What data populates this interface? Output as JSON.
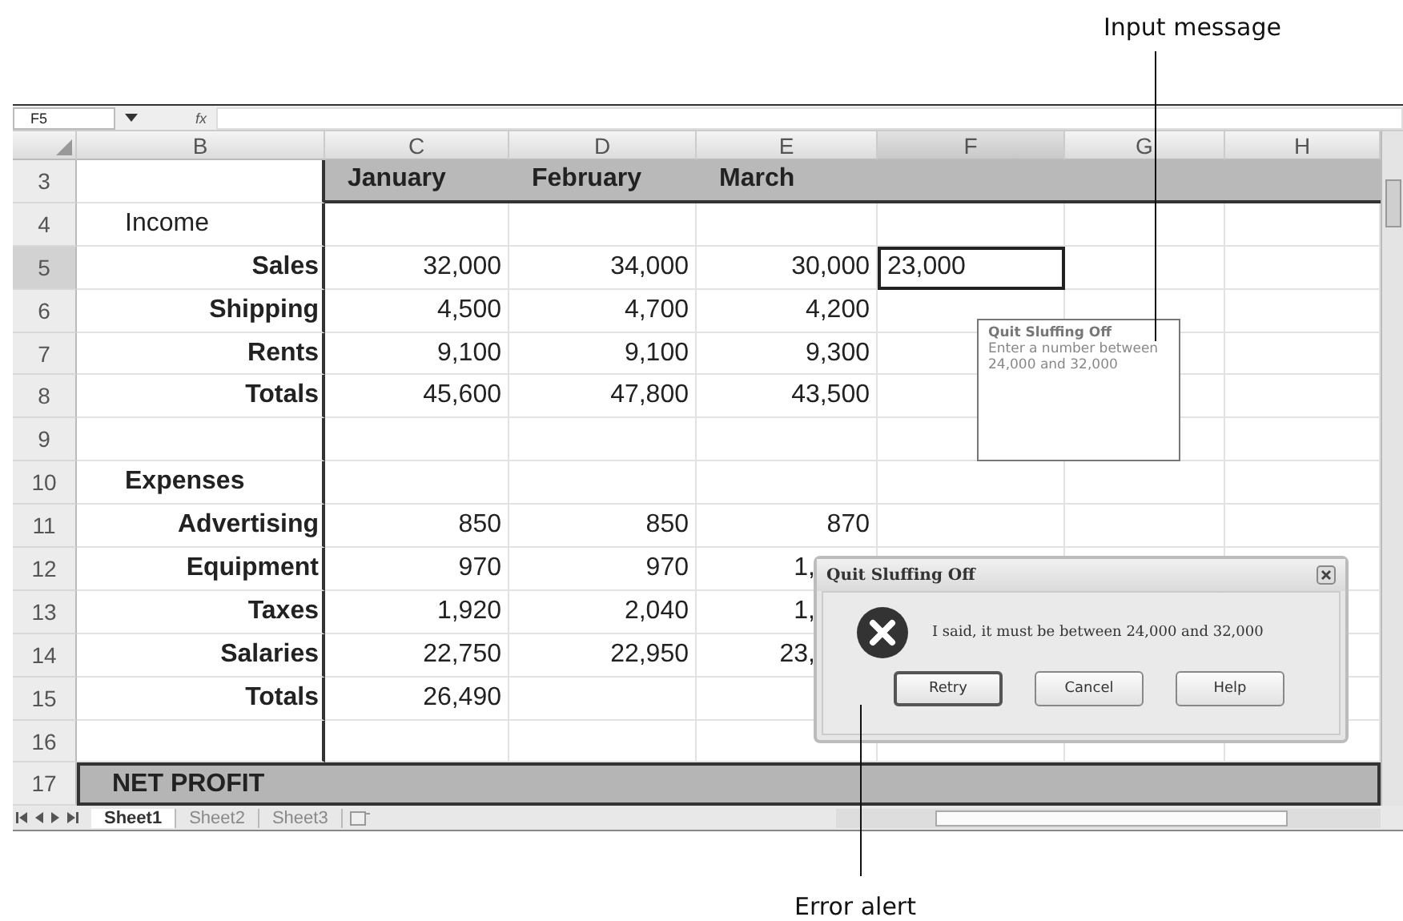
{
  "callouts": [
    {
      "kind": "top",
      "text": "Input message"
    },
    {
      "kind": "bottom",
      "text": "Error alert"
    }
  ],
  "formula_bar": {
    "name_box": "F5",
    "function_label": "fx"
  },
  "columns": [
    {
      "letter": "B",
      "selected": false
    },
    {
      "letter": "C",
      "selected": false
    },
    {
      "letter": "D",
      "selected": false
    },
    {
      "letter": "E",
      "selected": false
    },
    {
      "letter": "F",
      "selected": true
    },
    {
      "letter": "G",
      "selected": false
    },
    {
      "letter": "H",
      "selected": false
    }
  ],
  "rows": [
    {
      "number": "3",
      "kind": "header",
      "selected": false,
      "cells": [
        {
          "text": "January",
          "selected": false
        },
        {
          "text": "February",
          "selected": false
        },
        {
          "text": "March",
          "selected": false
        },
        null,
        null,
        null
      ]
    },
    {
      "number": "4",
      "kind": "group",
      "selected": false,
      "label": "Income",
      "bold": false,
      "cells": [
        null,
        null,
        null,
        null,
        null,
        null
      ]
    },
    {
      "number": "5",
      "kind": "item",
      "selected": true,
      "label": "Sales",
      "cells": [
        {
          "text": "32,000",
          "selected": false
        },
        {
          "text": "34,000",
          "selected": false
        },
        {
          "text": "30,000",
          "selected": false
        },
        {
          "text": "23,000",
          "selected": true
        },
        null,
        null
      ]
    },
    {
      "number": "6",
      "kind": "item",
      "selected": false,
      "label": "Shipping",
      "cells": [
        {
          "text": "4,500",
          "selected": false
        },
        {
          "text": "4,700",
          "selected": false
        },
        {
          "text": "4,200",
          "selected": false
        },
        null,
        null,
        null
      ]
    },
    {
      "number": "7",
      "kind": "item",
      "selected": false,
      "label": "Rents",
      "cells": [
        {
          "text": "9,100",
          "selected": false
        },
        {
          "text": "9,100",
          "selected": false
        },
        {
          "text": "9,300",
          "selected": false
        },
        null,
        null,
        null
      ]
    },
    {
      "number": "8",
      "kind": "item",
      "selected": false,
      "label": "Totals",
      "cells": [
        {
          "text": "45,600",
          "selected": false
        },
        {
          "text": "47,800",
          "selected": false
        },
        {
          "text": "43,500",
          "selected": false
        },
        null,
        null,
        null
      ]
    },
    {
      "number": "9",
      "kind": "blank",
      "selected": false,
      "cells": [
        null,
        null,
        null,
        null,
        null,
        null
      ]
    },
    {
      "number": "10",
      "kind": "group",
      "selected": false,
      "label": "Expenses",
      "bold": true,
      "cells": [
        null,
        null,
        null,
        null,
        null,
        null
      ]
    },
    {
      "number": "11",
      "kind": "item",
      "selected": false,
      "label": "Advertising",
      "cells": [
        {
          "text": "850",
          "selected": false
        },
        {
          "text": "850",
          "selected": false
        },
        {
          "text": "870",
          "selected": false
        },
        null,
        null,
        null
      ]
    },
    {
      "number": "12",
      "kind": "item",
      "selected": false,
      "label": "Equipment",
      "cells": [
        {
          "text": "970",
          "selected": false
        },
        {
          "text": "970",
          "selected": false
        },
        {
          "text": "1,",
          "selected": false,
          "covered": true
        },
        null,
        null,
        null
      ]
    },
    {
      "number": "13",
      "kind": "item",
      "selected": false,
      "label": "Taxes",
      "cells": [
        {
          "text": "1,920",
          "selected": false
        },
        {
          "text": "2,040",
          "selected": false
        },
        {
          "text": "1,",
          "selected": false,
          "covered": true
        },
        null,
        null,
        null
      ]
    },
    {
      "number": "14",
      "kind": "item",
      "selected": false,
      "label": "Salaries",
      "cells": [
        {
          "text": "22,750",
          "selected": false
        },
        {
          "text": "22,950",
          "selected": false
        },
        {
          "text": "23,",
          "selected": false,
          "covered": true
        },
        null,
        null,
        null
      ]
    },
    {
      "number": "15",
      "kind": "item",
      "selected": false,
      "label": "Totals",
      "cells": [
        {
          "text": "26,490",
          "selected": false
        },
        null,
        null,
        null,
        null,
        null
      ]
    },
    {
      "number": "16",
      "kind": "blank",
      "selected": false,
      "cells": [
        null,
        null,
        null,
        null,
        null,
        null
      ]
    },
    {
      "number": "17",
      "kind": "banner",
      "selected": false,
      "label": "NET PROFIT"
    }
  ],
  "sheet_tabs": [
    {
      "label": "Sheet1",
      "selected": true
    },
    {
      "label": "Sheet2",
      "selected": false
    },
    {
      "label": "Sheet3",
      "selected": false
    }
  ],
  "input_message": {
    "title": "Quit Sluffing Off",
    "body": "Enter a number between 24,000 and 32,000"
  },
  "error_dialog": {
    "title": "Quit Sluffing Off",
    "message": "I said, it must be between 24,000 and 32,000",
    "buttons": [
      {
        "label": "Retry",
        "default": true
      },
      {
        "label": "Cancel",
        "default": false
      },
      {
        "label": "Help",
        "default": false
      }
    ]
  }
}
